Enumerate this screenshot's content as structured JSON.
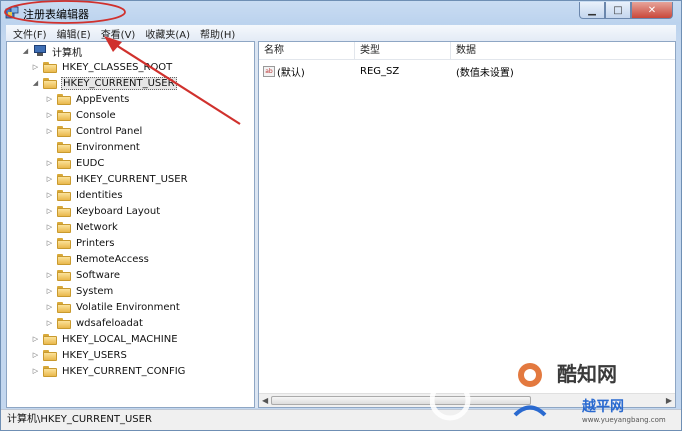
{
  "window": {
    "title": "注册表编辑器",
    "minimize_glyph": "▁",
    "maximize_glyph": "□",
    "close_glyph": "✕"
  },
  "menu": [
    {
      "label": "文件(F)"
    },
    {
      "label": "编辑(E)"
    },
    {
      "label": "查看(V)"
    },
    {
      "label": "收藏夹(A)"
    },
    {
      "label": "帮助(H)"
    }
  ],
  "tree": {
    "root_label": "计算机",
    "items": [
      {
        "label": "HKEY_CLASSES_ROOT",
        "level": 1,
        "toggle": "▷"
      },
      {
        "label": "HKEY_CURRENT_USER",
        "level": 1,
        "toggle": "◢",
        "selected": true
      },
      {
        "label": "AppEvents",
        "level": 2,
        "toggle": "▷"
      },
      {
        "label": "Console",
        "level": 2,
        "toggle": "▷"
      },
      {
        "label": "Control Panel",
        "level": 2,
        "toggle": "▷"
      },
      {
        "label": "Environment",
        "level": 2,
        "toggle": ""
      },
      {
        "label": "EUDC",
        "level": 2,
        "toggle": "▷"
      },
      {
        "label": "HKEY_CURRENT_USER",
        "level": 2,
        "toggle": "▷"
      },
      {
        "label": "Identities",
        "level": 2,
        "toggle": "▷"
      },
      {
        "label": "Keyboard Layout",
        "level": 2,
        "toggle": "▷"
      },
      {
        "label": "Network",
        "level": 2,
        "toggle": "▷"
      },
      {
        "label": "Printers",
        "level": 2,
        "toggle": "▷"
      },
      {
        "label": "RemoteAccess",
        "level": 2,
        "toggle": ""
      },
      {
        "label": "Software",
        "level": 2,
        "toggle": "▷"
      },
      {
        "label": "System",
        "level": 2,
        "toggle": "▷"
      },
      {
        "label": "Volatile Environment",
        "level": 2,
        "toggle": "▷"
      },
      {
        "label": "wdsafeloadat",
        "level": 2,
        "toggle": "▷"
      },
      {
        "label": "HKEY_LOCAL_MACHINE",
        "level": 1,
        "toggle": "▷"
      },
      {
        "label": "HKEY_USERS",
        "level": 1,
        "toggle": "▷"
      },
      {
        "label": "HKEY_CURRENT_CONFIG",
        "level": 1,
        "toggle": "▷"
      }
    ]
  },
  "list": {
    "columns": [
      "名称",
      "类型",
      "数据"
    ],
    "rows": [
      {
        "name": "(默认)",
        "type": "REG_SZ",
        "data": "(数值未设置)",
        "icon": "ab-icon"
      }
    ],
    "ab_glyph": "ab"
  },
  "status": {
    "path": "计算机\\HKEY_CURRENT_USER"
  },
  "watermark": {
    "line1": "酷知网",
    "line2": "越平网",
    "line3": "www.yueyangbang.com"
  },
  "colors": {
    "annotation": "#d0312d",
    "selection_bg": "#e6e6e6"
  }
}
